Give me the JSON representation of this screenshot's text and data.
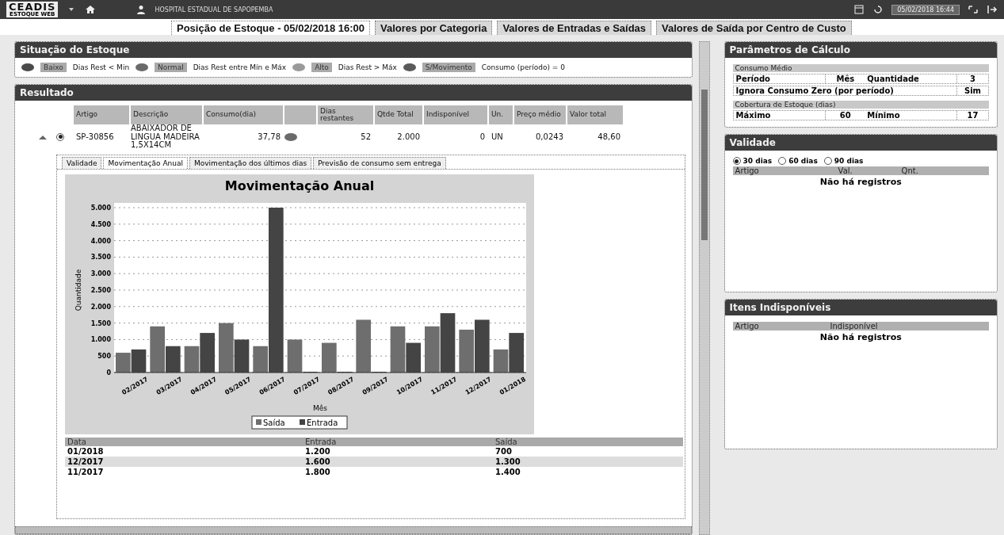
{
  "header": {
    "logo": "CEADIS",
    "logo_sub": "ESTOQUE WEB",
    "hospital": "HOSPITAL ESTADUAL DE SAPOPEMBA",
    "datetime": "05/02/2018 16:44"
  },
  "top_tabs": [
    {
      "label": "Posição de Estoque - 05/02/2018 16:00",
      "selected": true
    },
    {
      "label": "Valores por Categoria",
      "selected": false
    },
    {
      "label": "Valores de Entradas e Saídas",
      "selected": false
    },
    {
      "label": "Valores de Saída por Centro de Custo",
      "selected": false
    }
  ],
  "situacao": {
    "title": "Situação do Estoque",
    "legend": [
      {
        "label": "Baixo",
        "description": "Dias Rest < Min",
        "color": "#4a4a4a"
      },
      {
        "label": "Normal",
        "description": "Dias Rest entre Mín e Máx",
        "color": "#6a6a6a"
      },
      {
        "label": "Alto",
        "description": "Dias Rest > Máx",
        "color": "#9a9a9a"
      },
      {
        "label": "S/Movimento",
        "description": "Consumo (período) = 0",
        "color": "#5a5a5a"
      }
    ]
  },
  "resultado": {
    "title": "Resultado",
    "columns": [
      "Artigo",
      "Descrição",
      "Consumo(dia)",
      "Dias restantes",
      "Qtde Total",
      "Indisponível",
      "Un.",
      "Preço médio",
      "Valor total"
    ],
    "row": {
      "selected": true,
      "artigo": "SP-30856",
      "descricao": "ABAIXADOR DE LINGUA MADEIRA 1,5X14CM",
      "consumo": "37,78",
      "color": "#6a6a6a",
      "dias": "52",
      "qtde": "2.000",
      "indisponivel": "0",
      "un": "UN",
      "preco": "0,0243",
      "valor": "48,60"
    },
    "detail_tabs": [
      {
        "label": "Validade",
        "selected": false
      },
      {
        "label": "Movimentação Anual",
        "selected": true
      },
      {
        "label": "Movimentação dos últimos dias",
        "selected": false
      },
      {
        "label": "Previsão de consumo sem entrega",
        "selected": false
      }
    ],
    "chart_data": {
      "type": "bar",
      "title": "Movimentação Anual",
      "xlabel": "Mês",
      "ylabel": "Quantidade",
      "categories": [
        "02/2017",
        "03/2017",
        "04/2017",
        "05/2017",
        "06/2017",
        "07/2017",
        "08/2017",
        "09/2017",
        "10/2017",
        "11/2017",
        "12/2017",
        "01/2018"
      ],
      "series": [
        {
          "name": "Saída",
          "color": "#6e6e6e",
          "values": [
            600,
            1400,
            800,
            1500,
            800,
            1000,
            900,
            1600,
            1400,
            1400,
            1300,
            700
          ]
        },
        {
          "name": "Entrada",
          "color": "#444444",
          "values": [
            700,
            800,
            1200,
            1000,
            5000,
            0,
            0,
            0,
            900,
            1800,
            1600,
            1200
          ]
        }
      ],
      "ylim": [
        0,
        5000
      ],
      "grid": true,
      "legend": true,
      "yticks": [
        {
          "value": 0,
          "label": "0"
        },
        {
          "value": 500,
          "label": "500"
        },
        {
          "value": 1000,
          "label": "1.000"
        },
        {
          "value": 1500,
          "label": "1.500"
        },
        {
          "value": 2000,
          "label": "2.000"
        },
        {
          "value": 2500,
          "label": "2.500"
        },
        {
          "value": 3000,
          "label": "3.000"
        },
        {
          "value": 3500,
          "label": "3.500"
        },
        {
          "value": 4000,
          "label": "4.000"
        },
        {
          "value": 4500,
          "label": "4.500"
        },
        {
          "value": 5000,
          "label": "5.000"
        }
      ]
    },
    "table": {
      "columns": [
        "Data",
        "Entrada",
        "Saída"
      ],
      "rows": [
        [
          "01/2018",
          "1.200",
          "700"
        ],
        [
          "12/2017",
          "1.600",
          "1.300"
        ],
        [
          "11/2017",
          "1.800",
          "1.400"
        ]
      ]
    }
  },
  "parametros": {
    "title": "Parâmetros de Cálculo",
    "consumo": {
      "title": "Consumo Médio",
      "periodo_label": "Período",
      "periodo": "Mês",
      "quantidade_label": "Quantidade",
      "quantidade": "3",
      "ignora_label": "Ignora Consumo Zero (por período)",
      "ignora": "Sim"
    },
    "cobertura": {
      "title": "Cobertura de Estoque (dias)",
      "maximo_label": "Máximo",
      "maximo": "60",
      "minimo_label": "Mínimo",
      "minimo": "17"
    }
  },
  "validade": {
    "title": "Validade",
    "options": [
      {
        "label": "30 dias",
        "selected": true
      },
      {
        "label": "60 dias",
        "selected": false
      },
      {
        "label": "90 dias",
        "selected": false
      }
    ],
    "columns": [
      "Artigo",
      "Val.",
      "Qnt."
    ],
    "empty": "Não há registros"
  },
  "indisponiveis": {
    "title": "Itens Indisponíveis",
    "columns": [
      "Artigo",
      "Indisponível"
    ],
    "empty": "Não há registros"
  }
}
